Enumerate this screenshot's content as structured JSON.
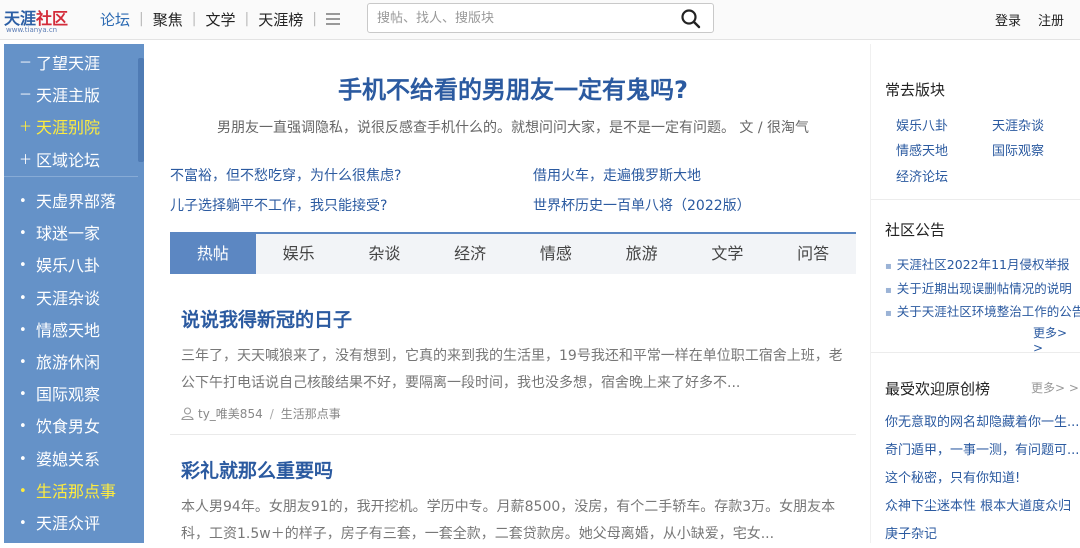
{
  "brand": {
    "logo_cn_blue": "天涯",
    "logo_cn_red": "社区",
    "logo_en": "www.tianya.cn"
  },
  "nav": {
    "items": [
      "论坛",
      "聚焦",
      "文学",
      "天涯榜"
    ],
    "active_index": 0,
    "menu_icon": "hamburger-icon"
  },
  "search": {
    "placeholder": "搜帖、找人、搜版块",
    "icon": "search-icon"
  },
  "auth": {
    "login": "登录",
    "register": "注册"
  },
  "sidebar": {
    "top_items": [
      {
        "marker": "－",
        "label": "了望天涯",
        "highlight": false
      },
      {
        "marker": "－",
        "label": "天涯主版",
        "highlight": false
      },
      {
        "marker": "＋",
        "label": "天涯别院",
        "highlight": true
      },
      {
        "marker": "＋",
        "label": "区域论坛",
        "highlight": false
      }
    ],
    "items": [
      {
        "marker": "•",
        "label": "天虚界部落",
        "highlight": false
      },
      {
        "marker": "•",
        "label": "球迷一家",
        "highlight": false
      },
      {
        "marker": "•",
        "label": "娱乐八卦",
        "highlight": false
      },
      {
        "marker": "•",
        "label": "天涯杂谈",
        "highlight": false
      },
      {
        "marker": "•",
        "label": "情感天地",
        "highlight": false
      },
      {
        "marker": "•",
        "label": "旅游休闲",
        "highlight": false
      },
      {
        "marker": "•",
        "label": "国际观察",
        "highlight": false
      },
      {
        "marker": "•",
        "label": "饮食男女",
        "highlight": false
      },
      {
        "marker": "•",
        "label": "婆媳关系",
        "highlight": false
      },
      {
        "marker": "•",
        "label": "生活那点事",
        "highlight": true
      },
      {
        "marker": "•",
        "label": "天涯众评",
        "highlight": false
      }
    ]
  },
  "main": {
    "headline": "手机不给看的男朋友一定有鬼吗?",
    "subline": "男朋友一直强调隐私，说很反感查手机什么的。就想问问大家，是不是一定有问题。 文 / 很淘气",
    "quick_links": [
      "不富裕，但不愁吃穿，为什么很焦虑?",
      "借用火车，走遍俄罗斯大地",
      "儿子选择躺平不工作，我只能接受?",
      "世界杯历史一百单八将（2022版）"
    ],
    "tabs": [
      "热帖",
      "娱乐",
      "杂谈",
      "经济",
      "情感",
      "旅游",
      "文学",
      "问答"
    ],
    "active_tab": 0,
    "posts": [
      {
        "title": "说说我得新冠的日子",
        "excerpt": "三年了，天天喊狼来了，没有想到，它真的来到我的生活里，19号我还和平常一样在单位职工宿舍上班，老公下午打电话说自己核酸结果不好，要隔离一段时间，我也没多想，宿舍晚上来了好多不...",
        "author": "ty_唯美854",
        "board": "生活那点事"
      },
      {
        "title": "彩礼就那么重要吗",
        "excerpt": "本人男94年。女朋友91的，我开挖机。学历中专。月薪8500，没房，有个二手轿车。存款3万。女朋友本科，工资1.5w＋的样子，房子有三套，一套全款，二套贷款房。她父母离婚，从小缺爱，宅女..."
      }
    ]
  },
  "right": {
    "frequent": {
      "heading": "常去版块",
      "links": [
        "娱乐八卦",
        "天涯杂谈",
        "情感天地",
        "国际观察",
        "经济论坛"
      ]
    },
    "notices": {
      "heading": "社区公告",
      "items": [
        "天涯社区2022年11月侵权举报",
        "关于近期出现误删帖情况的说明",
        "关于天涯社区环境整治工作的公告"
      ],
      "more": "更多> >"
    },
    "popular": {
      "heading": "最受欢迎原创榜",
      "more": "更多> >",
      "items": [
        "你无意取的网名却隐藏着你一生...",
        "奇门遁甲，一事一测，有问题可...",
        "这个秘密，只有你知道!",
        "众神下尘迷本性 根本大道度众归",
        "庚子杂记"
      ]
    }
  }
}
